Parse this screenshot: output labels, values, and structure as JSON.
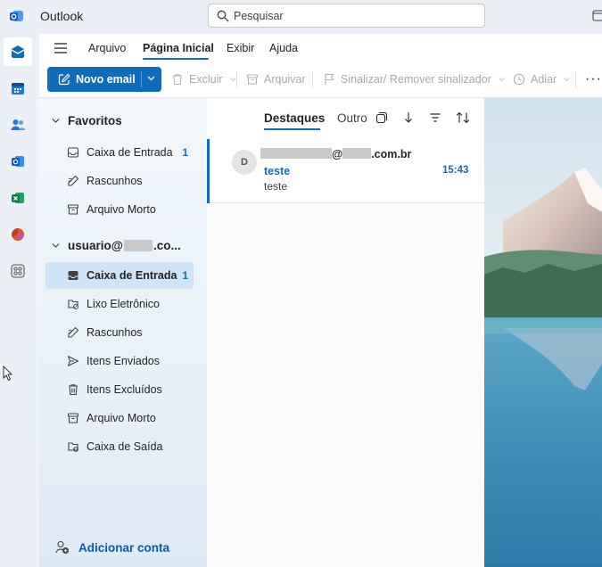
{
  "app": {
    "title": "Outlook"
  },
  "search": {
    "placeholder": "Pesquisar"
  },
  "ribbon": {
    "tabs": [
      "Arquivo",
      "Página Inicial",
      "Exibir",
      "Ajuda"
    ]
  },
  "toolbar": {
    "new_mail": "Novo email",
    "delete": "Excluir",
    "archive": "Arquivar",
    "flag": "Sinalizar/ Remover sinalizador",
    "snooze": "Adiar",
    "more": "···"
  },
  "favorites": {
    "title": "Favoritos",
    "items": [
      {
        "label": "Caixa de Entrada",
        "count": "1",
        "icon": "inbox-icon"
      },
      {
        "label": "Rascunhos",
        "count": "",
        "icon": "draft-icon"
      },
      {
        "label": "Arquivo Morto",
        "count": "",
        "icon": "archive-icon"
      }
    ]
  },
  "account": {
    "title": "usuario@",
    "title_suffix": ".co...",
    "items": [
      {
        "label": "Caixa de Entrada",
        "count": "1",
        "icon": "inbox-icon",
        "selected": true
      },
      {
        "label": "Lixo Eletrônico",
        "count": "",
        "icon": "junk-icon"
      },
      {
        "label": "Rascunhos",
        "count": "",
        "icon": "draft-icon"
      },
      {
        "label": "Itens Enviados",
        "count": "",
        "icon": "send-icon"
      },
      {
        "label": "Itens Excluídos",
        "count": "",
        "icon": "trash-icon"
      },
      {
        "label": "Arquivo Morto",
        "count": "",
        "icon": "archive-icon"
      },
      {
        "label": "Caixa de Saída",
        "count": "",
        "icon": "outbox-icon"
      }
    ]
  },
  "add_account": "Adicionar conta",
  "message_list": {
    "tabs": [
      "Destaques",
      "Outro"
    ],
    "active_tab": "Destaques",
    "messages": [
      {
        "avatar_initial": "D",
        "sender_at": "@",
        "sender_domain": ".com.br",
        "subject": "teste",
        "time": "15:43",
        "preview": "teste",
        "unread": true
      }
    ]
  },
  "colors": {
    "accent": "#0f6cbd",
    "selected": "#cfe4f7"
  }
}
